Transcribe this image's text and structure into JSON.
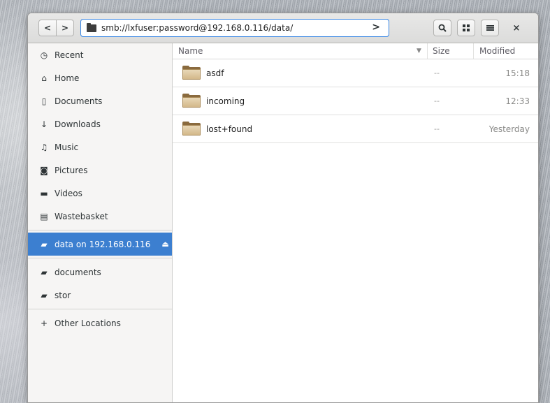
{
  "headerbar": {
    "back_label": "<",
    "forward_label": ">",
    "path": "smb://lxfuser:password@192.168.0.116/data/",
    "go_label": ">",
    "close_label": "×"
  },
  "sidebar": {
    "items": [
      {
        "label": "Recent",
        "icon": "clock-icon"
      },
      {
        "label": "Home",
        "icon": "home-icon"
      },
      {
        "label": "Documents",
        "icon": "document-icon"
      },
      {
        "label": "Downloads",
        "icon": "download-icon"
      },
      {
        "label": "Music",
        "icon": "music-icon"
      },
      {
        "label": "Pictures",
        "icon": "camera-icon"
      },
      {
        "label": "Videos",
        "icon": "video-icon"
      },
      {
        "label": "Wastebasket",
        "icon": "trash-icon"
      }
    ],
    "mount": {
      "label": "data on 192.168.0.116",
      "icon": "network-folder-icon"
    },
    "bookmarks": [
      {
        "label": "documents",
        "icon": "folder-icon"
      },
      {
        "label": "stor",
        "icon": "folder-icon"
      }
    ],
    "other_locations": "Other Locations"
  },
  "columns": {
    "name": "Name",
    "size": "Size",
    "modified": "Modified"
  },
  "files": [
    {
      "name": "asdf",
      "size": "--",
      "modified": "15:18"
    },
    {
      "name": "incoming",
      "size": "--",
      "modified": "12:33"
    },
    {
      "name": "lost+found",
      "size": "--",
      "modified": "Yesterday"
    }
  ],
  "colors": {
    "accent": "#3c7fd0",
    "selected_sidebar": "#3c7fd0"
  }
}
